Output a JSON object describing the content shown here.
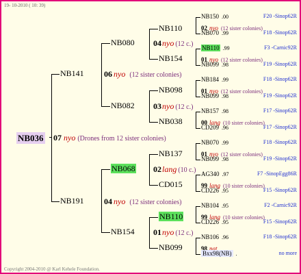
{
  "header": {
    "date": "19- 10-2010 ( 10: 39)"
  },
  "footer": {
    "copyright": "Copyright 2004-2010 @ Karl Kehele Foundation."
  },
  "root": {
    "name": "NB036",
    "gen": "07",
    "mark": "nyo",
    "desc": "(Drones from 12 sister colonies)"
  },
  "level1": [
    {
      "name": "NB141",
      "gen": "06",
      "mark": "nyo",
      "desc": "(12 sister colonies)"
    },
    {
      "name": "NB191",
      "gen": "04",
      "mark": "nyo",
      "desc": "(12 sister colonies)"
    }
  ],
  "level2": [
    {
      "name": "NB080",
      "gen": "04",
      "mark": "nyo",
      "desc": "(12 c.)"
    },
    {
      "name": "NB082",
      "gen": "03",
      "mark": "nyo",
      "desc": "(12 c.)"
    },
    {
      "name": "NB068",
      "gen": "02",
      "mark": "lang",
      "desc": "(10 c.)"
    },
    {
      "name": "NB154",
      "gen": "01",
      "mark": "nyo",
      "desc": "(12 c.)"
    }
  ],
  "level3": [
    {
      "name": "NB110"
    },
    {
      "name": "NB154"
    },
    {
      "name": "NB098"
    },
    {
      "name": "NB038"
    },
    {
      "name": "NB137"
    },
    {
      "name": "CD015"
    },
    {
      "name": "NB110"
    },
    {
      "name": "NB099"
    }
  ],
  "leaves": [
    {
      "top": "NB150",
      "ts": ".00",
      "tr": "F20 -Sinop62R",
      "gen": "02",
      "mark": "nyo",
      "sis": "(12 sister colonies)",
      "bot": "NB070",
      "bs": ".99",
      "br": "F18 -Sinop62R"
    },
    {
      "top": "NB110",
      "ts": ".99",
      "tr": "F3 -Carnic92R",
      "gen": "01",
      "mark": "nyo",
      "sis": "(12 sister colonies)",
      "bot": "NB099",
      "bs": ".98",
      "br": "F19 -Sinop62R"
    },
    {
      "top": "NB184",
      "ts": ".99",
      "tr": "F18 -Sinop62R",
      "gen": "01",
      "mark": "nyo",
      "sis": "(12 sister colonies)",
      "bot": "NB099",
      "bs": ".98",
      "br": "F19 -Sinop62R"
    },
    {
      "top": "NB157",
      "ts": ".98",
      "tr": "F17 -Sinop62R",
      "gen": "00",
      "mark": "lang",
      "sis": "(10 sister colonies)",
      "bot": "CD209",
      "bs": ".96",
      "br": "F17 -Sinop62R"
    },
    {
      "top": "NB070",
      "ts": ".99",
      "tr": "F18 -Sinop62R",
      "gen": "01",
      "mark": "nyo",
      "sis": "(12 sister colonies)",
      "bot": "NB099",
      "bs": ".98",
      "br": "F19 -Sinop62R"
    },
    {
      "top": "AG340",
      "ts": ".97",
      "tr": "F7 -SinopEgg86R",
      "gen": "99",
      "mark": "lang",
      "sis": "(10 sister colonies)",
      "bot": "CD226",
      "bs": ".95",
      "br": "F15 -Sinop62R"
    },
    {
      "top": "NB104",
      "ts": ".95",
      "tr": "F2 -Carnic92R",
      "gen": "99",
      "mark": "lang",
      "sis": "(10 sister colonies)",
      "bot": "CD226",
      "bs": ".95",
      "br": "F15 -Sinop62R"
    },
    {
      "top": "NB106",
      "ts": ".96",
      "tr": "F18 -Sinop62R",
      "gen": "98",
      "mark": "nat",
      "sis": "",
      "bot": "Bxx98(NB)",
      "bs": ".",
      "br": "no more"
    }
  ]
}
